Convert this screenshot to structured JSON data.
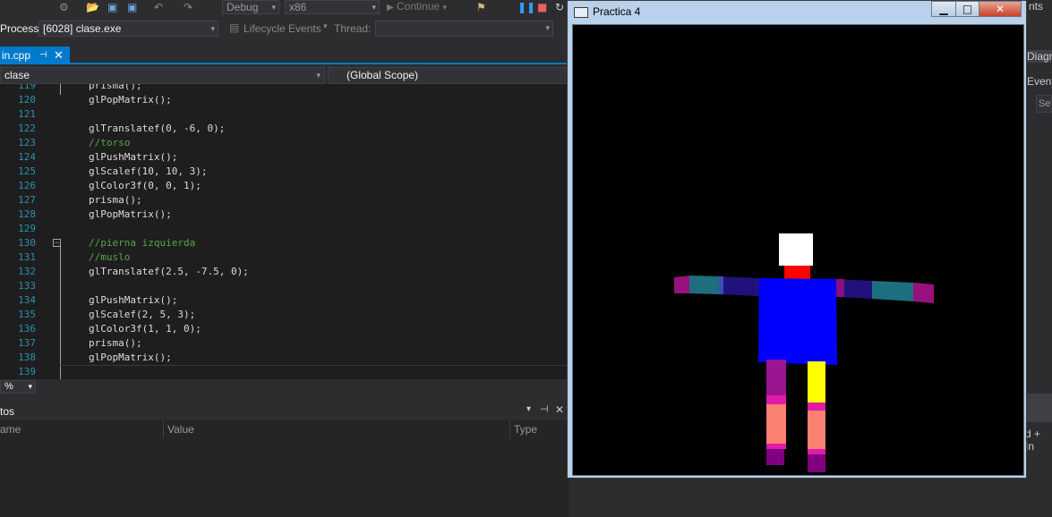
{
  "toolbar": {
    "config_combo": "Debug",
    "platform_combo": "x86",
    "continue_label": "Continue"
  },
  "process_bar": {
    "process_label": "Process:",
    "process_value": "[6028] clase.exe",
    "lifecycle_label": "Lifecycle Events",
    "thread_label": "Thread:"
  },
  "tab": {
    "title": "in.cpp"
  },
  "navbar": {
    "left_combo": "clase",
    "right_combo": "(Global Scope)"
  },
  "editor": {
    "lines": [
      {
        "num": "119",
        "code": "prisma();",
        "indent": 1,
        "comment": false
      },
      {
        "num": "120",
        "code": "glPopMatrix();",
        "indent": 1,
        "comment": false
      },
      {
        "num": "121",
        "code": "",
        "indent": 1,
        "comment": false
      },
      {
        "num": "122",
        "code": "glTranslatef(0, -6, 0);",
        "indent": 1,
        "comment": false
      },
      {
        "num": "123",
        "code": "//torso",
        "indent": 1,
        "comment": true
      },
      {
        "num": "124",
        "code": "glPushMatrix();",
        "indent": 1,
        "comment": false
      },
      {
        "num": "125",
        "code": "glScalef(10, 10, 3);",
        "indent": 1,
        "comment": false
      },
      {
        "num": "126",
        "code": "glColor3f(0, 0, 1);",
        "indent": 1,
        "comment": false
      },
      {
        "num": "127",
        "code": "prisma();",
        "indent": 1,
        "comment": false
      },
      {
        "num": "128",
        "code": "glPopMatrix();",
        "indent": 1,
        "comment": false
      },
      {
        "num": "129",
        "code": "",
        "indent": 1,
        "comment": false
      },
      {
        "num": "130",
        "code": "//pierna izquierda",
        "indent": 1,
        "comment": true
      },
      {
        "num": "131",
        "code": "//muslo",
        "indent": 1,
        "comment": true
      },
      {
        "num": "132",
        "code": "glTranslatef(2.5, -7.5, 0);",
        "indent": 1,
        "comment": false
      },
      {
        "num": "133",
        "code": "",
        "indent": 1,
        "comment": false
      },
      {
        "num": "134",
        "code": "glPushMatrix();",
        "indent": 1,
        "comment": false
      },
      {
        "num": "135",
        "code": "glScalef(2, 5, 3);",
        "indent": 1,
        "comment": false
      },
      {
        "num": "136",
        "code": "glColor3f(1, 1, 0);",
        "indent": 1,
        "comment": false
      },
      {
        "num": "137",
        "code": "prisma();",
        "indent": 1,
        "comment": false
      },
      {
        "num": "138",
        "code": "glPopMatrix();",
        "indent": 1,
        "comment": false
      },
      {
        "num": "139",
        "code": "",
        "indent": 1,
        "comment": false
      }
    ]
  },
  "zoom": {
    "value": "%"
  },
  "autos": {
    "title": "tos",
    "col_name": "ame",
    "col_value": "Value",
    "col_type": "Type"
  },
  "right_side": {
    "nts": "nts",
    "diagn": "Diagn",
    "event": "Event",
    "se": "Se",
    "plus_in": "d + In"
  },
  "window": {
    "title": "Practica 4"
  },
  "colors": {
    "accent": "#007acc",
    "torso": "#0000ff",
    "head": "#ffffff",
    "neck": "#ff0000",
    "upper_leg_left": "#9b1491",
    "upper_leg_right": "#ffff00",
    "lower_leg": "#fa8072",
    "foot": "#800080"
  }
}
